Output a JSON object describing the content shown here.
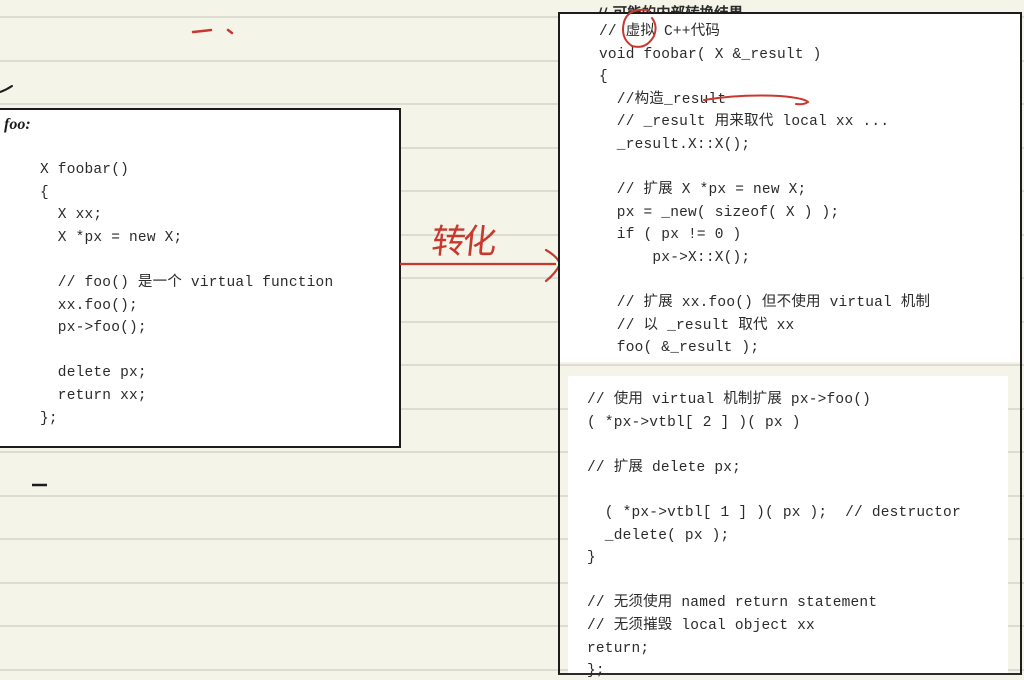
{
  "left_box": {
    "label": "foo:",
    "lines": [
      "X foobar()",
      "{",
      "  X xx;",
      "  X *px = new X;",
      "",
      "  // foo() 是一个 virtual function",
      "  xx.foo();",
      "  px->foo();",
      "",
      "  delete px;",
      "  return xx;",
      "};"
    ]
  },
  "annotation": {
    "handwritten_note": "转化",
    "ink_color": "#c8382e"
  },
  "right_box": {
    "header_comment": "// 可能的内部转换结果",
    "upper_lines": [
      "// 虚拟 C++代码",
      "void foobar( X &_result )",
      "{",
      "  //构造_result",
      "  // _result 用来取代 local xx ...",
      "  _result.X::X();",
      "",
      "  // 扩展 X *px = new X;",
      "  px = _new( sizeof( X ) );",
      "  if ( px != 0 )",
      "      px->X::X();",
      "",
      "  // 扩展 xx.foo() 但不使用 virtual 机制",
      "  // 以 _result 取代 xx",
      "  foo( &_result );"
    ],
    "lower_lines": [
      "// 使用 virtual 机制扩展 px->foo()",
      "( *px->vtbl[ 2 ] )( px )",
      "",
      "// 扩展 delete px;",
      "",
      "  ( *px->vtbl[ 1 ] )( px );  // destructor",
      "  _delete( px );",
      "}",
      "",
      "// 无须使用 named return statement",
      "// 无须摧毁 local object xx",
      "return;",
      "};"
    ]
  }
}
